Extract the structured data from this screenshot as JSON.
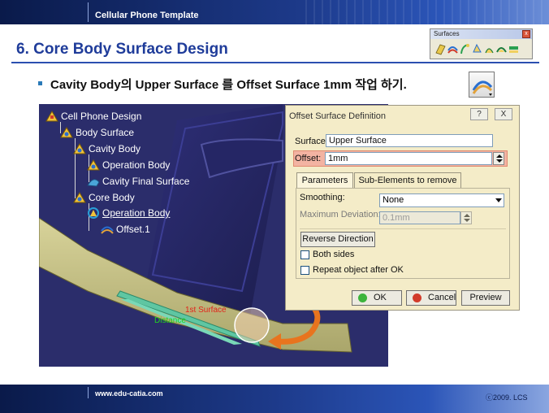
{
  "header": {
    "title": "Cellular Phone Template"
  },
  "slide": {
    "title": "6. Core Body Surface Design",
    "instruction": "Cavity Body의 Upper Surface 를 Offset  Surface 1mm 작업 하기."
  },
  "surfaces_toolbar": {
    "title": "Surfaces",
    "icons": [
      "extrude-surface-icon",
      "offset-surface-icon",
      "sweep-surface-icon",
      "fill-surface-icon",
      "multi-section-surface-icon",
      "blend-surface-icon",
      "offset-variant-icon"
    ]
  },
  "tree": {
    "items": [
      {
        "label": "Cell Phone Design",
        "icon": "part-icon",
        "underlined": false
      },
      {
        "label": "Body Surface",
        "icon": "geometrical-set-icon",
        "underlined": false
      },
      {
        "label": "Cavity Body",
        "icon": "geometrical-set-icon",
        "underlined": false
      },
      {
        "label": "Operation Body",
        "icon": "geometrical-set-icon",
        "underlined": false
      },
      {
        "label": "Cavity Final Surface",
        "icon": "surface-icon",
        "underlined": false
      },
      {
        "label": "Core Body",
        "icon": "geometrical-set-icon",
        "underlined": false
      },
      {
        "label": "Operation Body",
        "icon": "geometrical-set-icon",
        "underlined": true
      },
      {
        "label": "Offset.1",
        "icon": "offset-surface-icon",
        "underlined": false
      }
    ]
  },
  "viewport": {
    "annotation_red": "1st Surface",
    "annotation_green": "Distance"
  },
  "dialog": {
    "title": "Offset Surface Definition",
    "help_label": "?",
    "close_label": "X",
    "surface_label": "Surface:",
    "surface_value": "Upper Surface",
    "offset_label": "Offset:",
    "offset_value": "1mm",
    "tabs": [
      "Parameters",
      "Sub-Elements to remove"
    ],
    "smoothing_label": "Smoothing:",
    "smoothing_value": "None",
    "max_deviation_label": "Maximum Deviation:",
    "max_deviation_value": "0.1mm",
    "reverse_label": "Reverse Direction",
    "both_sides_label": "Both sides",
    "repeat_label": "Repeat object after OK",
    "ok_label": "OK",
    "cancel_label": "Cancel",
    "preview_label": "Preview"
  },
  "footer": {
    "url": "www.edu-catia.com",
    "copyright": "ⓒ2009. LCS"
  },
  "colors": {
    "title_blue": "#1f3c9a",
    "header_navy": "#0a1a4a",
    "viewport_bg": "#2b2d6b",
    "dialog_bg": "#f4ecc8",
    "highlight": "#f3b3a2"
  }
}
